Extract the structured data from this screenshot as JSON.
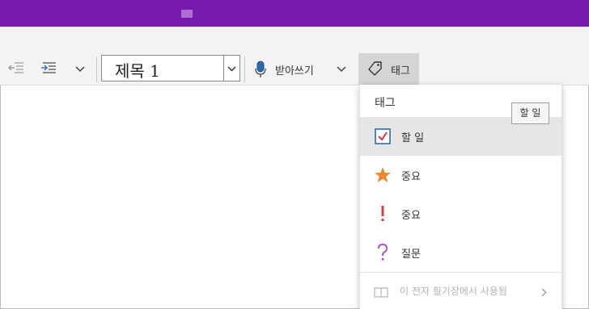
{
  "ribbon": {
    "style_value": "제목 1",
    "dictate_label": "받아쓰기",
    "tag_label": "태그"
  },
  "tag_menu": {
    "header": "태그",
    "items": [
      {
        "label": "할 일",
        "icon": "checkbox-icon",
        "selected": true
      },
      {
        "label": "중요",
        "icon": "star-icon",
        "color": "#e8892b"
      },
      {
        "label": "중요",
        "icon": "exclamation-icon",
        "color": "#e03b3b"
      },
      {
        "label": "질문",
        "icon": "question-icon",
        "color": "#b04fc4"
      }
    ],
    "footer": "이 전자 필기장에서 사용됨"
  },
  "tooltip": "할 일",
  "colors": {
    "titlebar": "#7719aa",
    "accent_blue": "#2b6cb0",
    "check_red": "#d9363e"
  }
}
